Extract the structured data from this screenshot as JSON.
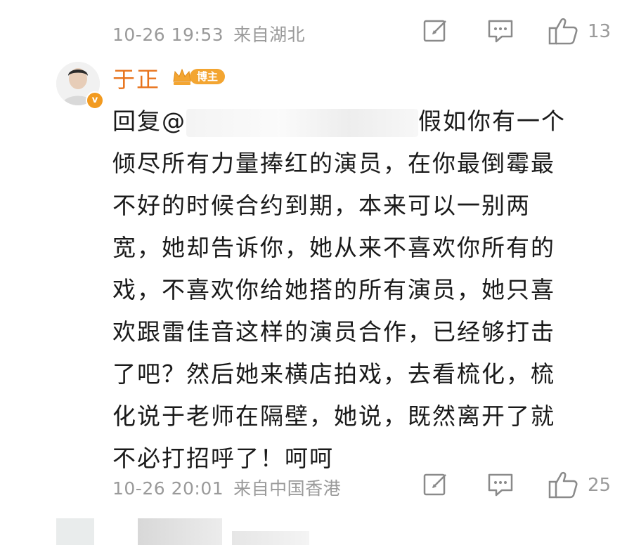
{
  "previous_comment": {
    "timestamp": "10-26 19:53",
    "location": "来自湖北",
    "like_count": "13",
    "icons": [
      "edit-icon",
      "comment-icon",
      "thumbs-up-icon"
    ]
  },
  "comment": {
    "username": "于正",
    "badge_label": "博主",
    "verified_mark": "v",
    "reply_prefix": "回复@",
    "lines": [
      "假如你有一个",
      "倾尽所有力量捧红的演员，在你最倒霉最",
      "不好的时候合约到期，本来可以一别两",
      "宽，她却告诉你，她从来不喜欢你所有的",
      "戏，不喜欢你给她搭的所有演员，她只喜",
      "欢跟雷佳音这样的演员合作，已经够打击",
      "了吧？然后她来横店拍戏，去看梳化，梳",
      "化说于老师在隔壁，她说，既然离开了就",
      "不必打招呼了！呵呵"
    ],
    "timestamp": "10-26 20:01",
    "location": "来自中国香港",
    "like_count": "25",
    "icons": [
      "edit-icon",
      "comment-icon",
      "thumbs-up-icon"
    ]
  },
  "colors": {
    "username": "#e8741d",
    "meta_text": "#9a9a9a",
    "badge": "#f3a531",
    "body_text": "#1a1a1a"
  }
}
